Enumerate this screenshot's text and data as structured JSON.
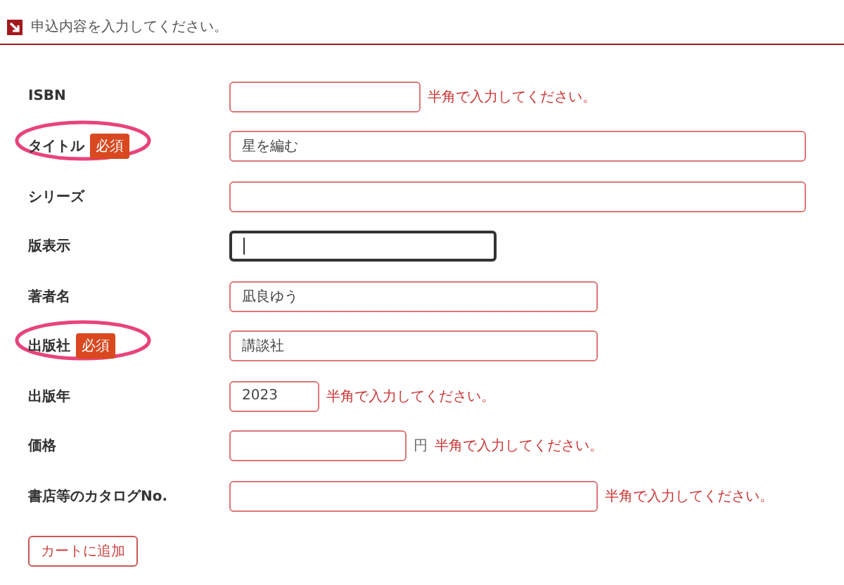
{
  "header": {
    "title": "申込内容を入力してください。"
  },
  "fields": [
    {
      "label": "ISBN",
      "circled": false,
      "kind": "short",
      "focused": false,
      "hint": "半角で入力してください。"
    },
    {
      "label": "タイトル",
      "badge": "必須",
      "circled": true,
      "kind": "long",
      "value": "星を編む",
      "focused": false
    },
    {
      "label": "シリーズ",
      "circled": false,
      "kind": "long",
      "focused": false
    },
    {
      "label": "版表示",
      "circled": false,
      "kind": "half",
      "focused": true
    },
    {
      "label": "著者名",
      "circled": false,
      "kind": "medium",
      "value": "凪良ゆう",
      "focused": false
    },
    {
      "label": "出版社",
      "badge": "必須",
      "circled": true,
      "kind": "medium",
      "value": "講談社",
      "focused": false
    },
    {
      "label": "出版年",
      "circled": false,
      "kind": "tiny",
      "value": "2023",
      "focused": false,
      "hint": "半角で入力してください。"
    },
    {
      "label": "価格",
      "circled": false,
      "kind": "price",
      "focused": false,
      "unit": "円",
      "hint": "半角で入力してください。"
    },
    {
      "label": "書店等のカタログNo.",
      "circled": false,
      "kind": "medium",
      "focused": false,
      "hint": "半角で入力してください。"
    }
  ],
  "submit": "カートに追加"
}
